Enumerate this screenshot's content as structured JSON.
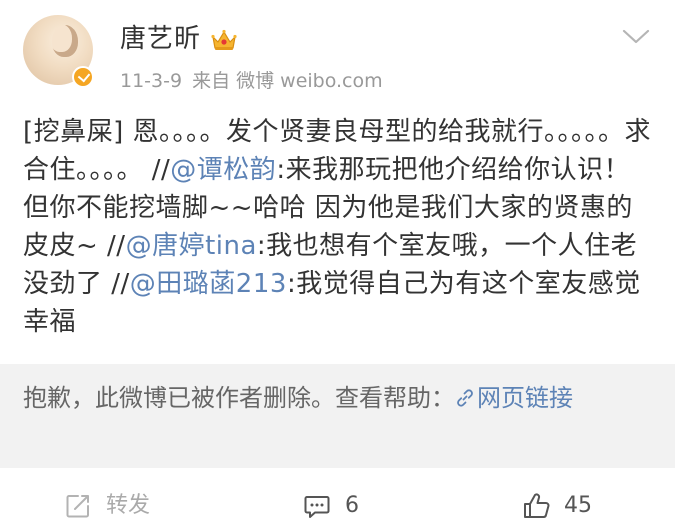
{
  "post": {
    "author": {
      "name": "唐艺昕",
      "verified": true
    },
    "meta": {
      "date": "11-3-9",
      "source": "来自 微博 weibo.com"
    },
    "content": {
      "part1": "[挖鼻屎] 恩。。。。发个贤妻良母型的给我就行。。。。。求合住。。。。 //",
      "mention1": "@谭松韵",
      "part2": ":来我那玩把他介绍给你认识！但你不能挖墙脚~~哈哈 因为他是我们大家的贤惠的皮皮~ //",
      "mention2": "@唐婷tina",
      "part3": ":我也想有个室友哦，一个人住老没劲了 //",
      "mention3": "@田璐菡213",
      "part4": ":我觉得自己为有这个室友感觉幸福"
    },
    "deleted_notice": {
      "text": "抱歉，此微博已被作者删除。查看帮助：",
      "link_label": "网页链接"
    },
    "actions": {
      "repost_label": "转发",
      "comment_count": "6",
      "like_count": "45"
    },
    "colors": {
      "link": "#5d83b6",
      "badge": "#f5a623",
      "notice_bg": "#f2f2f2"
    }
  }
}
